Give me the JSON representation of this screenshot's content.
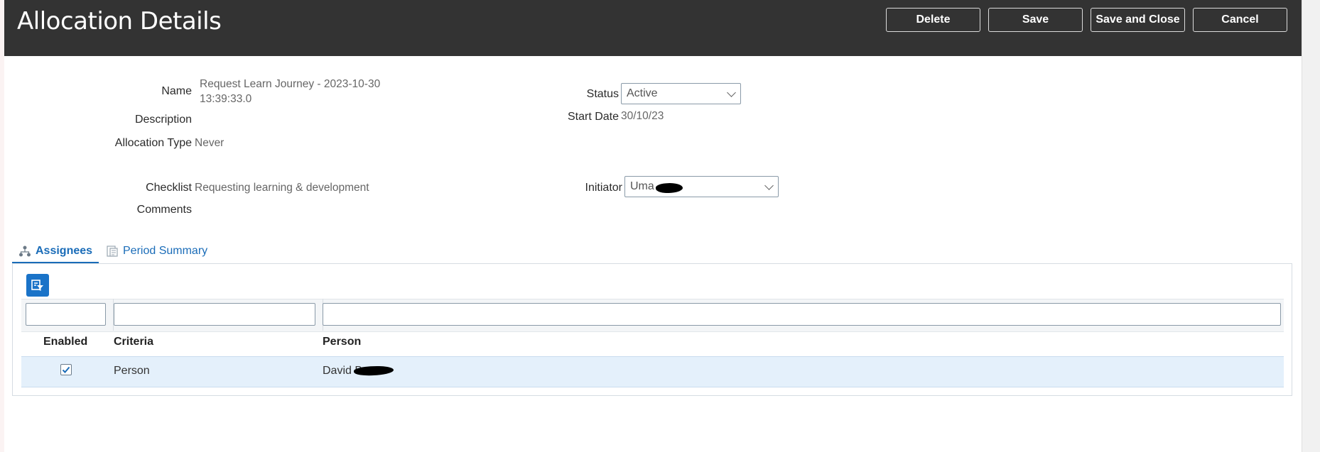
{
  "header": {
    "title": "Allocation Details",
    "buttons": {
      "delete": "Delete",
      "save": "Save",
      "save_and_close": "Save and Close",
      "cancel": "Cancel"
    }
  },
  "form": {
    "name_label": "Name",
    "name_line1": "Request Learn Journey - 2023-10-30",
    "name_line2": "13:39:33.0",
    "description_label": "Description",
    "allocation_type_label": "Allocation Type",
    "allocation_type_value": "Never",
    "checklist_label": "Checklist",
    "checklist_value": "Requesting learning & development",
    "comments_label": "Comments",
    "status_label": "Status",
    "status_value": "Active",
    "start_date_label": "Start Date",
    "start_date_value": "30/10/23",
    "initiator_label": "Initiator",
    "initiator_value": "Uma"
  },
  "tabs": {
    "assignees": "Assignees",
    "period_summary": "Period Summary",
    "active": "assignees"
  },
  "table": {
    "columns": [
      "Enabled",
      "Criteria",
      "Person"
    ],
    "rows": [
      {
        "enabled": true,
        "criteria": "Person",
        "person": "David B"
      }
    ]
  },
  "icons": {
    "filter": "filter-icon",
    "assignees_tab": "hierarchy-icon",
    "period_summary_tab": "report-icon",
    "select_chevron": "chevron-down-icon",
    "checkbox": "check-icon"
  },
  "colors": {
    "header_bg": "#333333",
    "accent": "#1a6cb8",
    "row_highlight": "#e4f0fb"
  }
}
